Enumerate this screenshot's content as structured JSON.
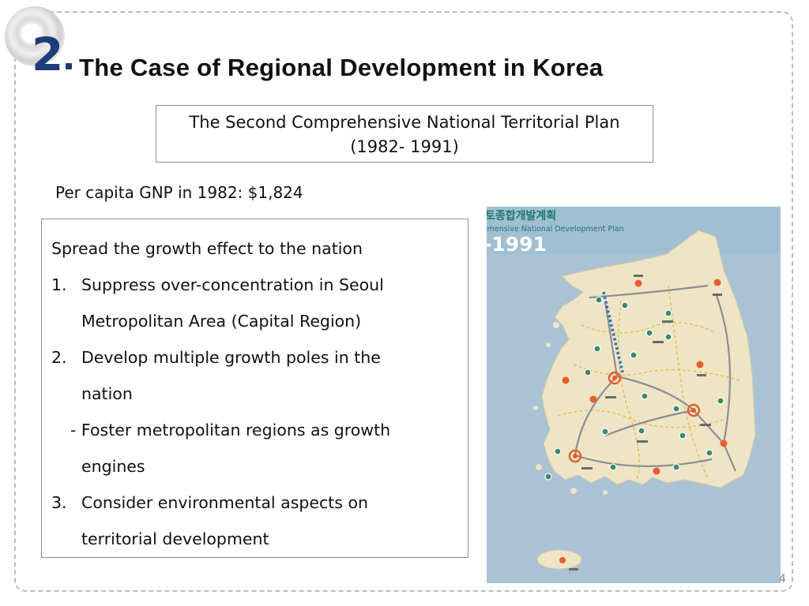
{
  "slide": {
    "number": "2",
    "title": "The Case of Regional Development in Korea",
    "page_number": "4"
  },
  "plan": {
    "line1": "The Second Comprehensive National Territorial Plan",
    "line2": "(1982- 1991)"
  },
  "gnp_text": "Per capita GNP in 1982: $1,824",
  "list": {
    "heading": "Spread the growth effect to the nation",
    "items": [
      {
        "num": "1.",
        "line1": "Suppress over-concentration in Seoul",
        "line2": "Metropolitan Area (Capital Region)"
      },
      {
        "num": "2.",
        "line1": "Develop multiple growth poles in the",
        "line2": "nation"
      },
      {
        "num": "3.",
        "line1": "Consider environmental aspects on",
        "line2": "territorial development"
      }
    ],
    "sub_line1": "- Foster metropolitan regions as growth",
    "sub_line2": "engines"
  },
  "map": {
    "title_korean": "토종합개발계획",
    "title_english": "ehensive National Development Plan",
    "title_years": "-1991",
    "colors": {
      "sea": "#a9c3d4",
      "land": "#eee4c6",
      "pole": "#e4602f",
      "node": "#3d8a6c",
      "route": "#8b8f94",
      "axis": "#2e6fb3"
    }
  }
}
